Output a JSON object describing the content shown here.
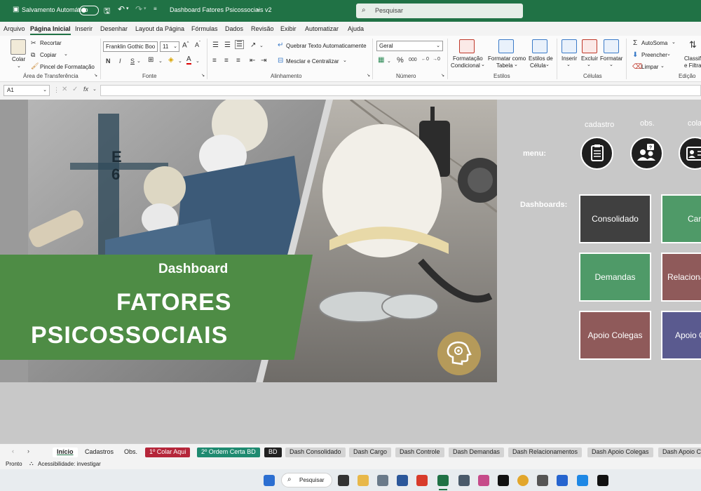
{
  "titlebar": {
    "autosave_label": "Salvamento Automático",
    "doc_title": "Dashboard Fatores Psicossociais v2",
    "search_placeholder": "Pesquisar"
  },
  "menu_tabs": [
    "Arquivo",
    "Página Inicial",
    "Inserir",
    "Desenhar",
    "Layout da Página",
    "Fórmulas",
    "Dados",
    "Revisão",
    "Exibir",
    "Automatizar",
    "Ajuda"
  ],
  "ribbon": {
    "colar": "Colar",
    "recortar": "Recortar",
    "copiar": "Copiar",
    "pincel": "Pincel de Formatação",
    "group_clipboard": "Área de Transferência",
    "font_name": "Franklin Gothic Boo",
    "font_size": "11",
    "group_font": "Fonte",
    "wrap_text": "Quebrar Texto Automaticamente",
    "merge_center": "Mesclar e Centralizar",
    "group_alignment": "Alinhamento",
    "number_format": "Geral",
    "group_number": "Número",
    "cond_format": [
      "Formatação",
      "Condicional"
    ],
    "format_table": [
      "Formatar como",
      "Tabela"
    ],
    "cell_styles": [
      "Estilos de",
      "Célula"
    ],
    "group_styles": "Estilos",
    "insert": "Inserir",
    "delete": "Excluir",
    "format": "Formatar",
    "group_cells": "Células",
    "autosum": "AutoSoma",
    "fill": "Preencher",
    "clear": "Limpar",
    "sort_filter": [
      "Classifi",
      "e Filtra"
    ],
    "group_editing": "Edição"
  },
  "formula_bar": {
    "name_box": "A1",
    "fx": "fx"
  },
  "hero": {
    "subtitle": "Dashboard",
    "title_line1": "FATORES",
    "title_line2": "PSICOSSOCIAIS",
    "sign_letter": "E",
    "sign_number": "6"
  },
  "menu": {
    "label": "menu:",
    "items": [
      {
        "label": "cadastro",
        "icon": "clipboard-icon"
      },
      {
        "label": "obs.",
        "icon": "person-question-icon"
      },
      {
        "label": "cola",
        "icon": "id-card-icon"
      }
    ]
  },
  "dashboards": {
    "label": "Dashboards:",
    "buttons": [
      {
        "label": "Consolidado",
        "color": "#404040"
      },
      {
        "label": "Carg",
        "color": "#4f9a68"
      },
      {
        "label": "Demandas",
        "color": "#4f9a68"
      },
      {
        "label": "Relaciona",
        "color": "#8f5a5a"
      },
      {
        "label": "Apoio Colegas",
        "color": "#8f5a5a"
      },
      {
        "label": "Apoio C",
        "color": "#5a5a8f"
      }
    ]
  },
  "sheet_tabs": [
    {
      "label": "Início",
      "bg": "#ffffff",
      "fg": "#222222"
    },
    {
      "label": "Cadastros",
      "bg": "#f3f3f3",
      "fg": "#222222"
    },
    {
      "label": "Obs.",
      "bg": "#f3f3f3",
      "fg": "#222222"
    },
    {
      "label": "1º Colar Aqui",
      "bg": "#b5263a",
      "fg": "#ffffff"
    },
    {
      "label": "2º Ordem Certa BD",
      "bg": "#1f8a70",
      "fg": "#ffffff"
    },
    {
      "label": "BD",
      "bg": "#222222",
      "fg": "#ffffff"
    },
    {
      "label": "Dash Consolidado",
      "bg": "#d4d4d4",
      "fg": "#222222"
    },
    {
      "label": "Dash Cargo",
      "bg": "#d4d4d4",
      "fg": "#222222"
    },
    {
      "label": "Dash Controle",
      "bg": "#d4d4d4",
      "fg": "#222222"
    },
    {
      "label": "Dash Demandas",
      "bg": "#d4d4d4",
      "fg": "#222222"
    },
    {
      "label": "Dash Relacionamentos",
      "bg": "#d4d4d4",
      "fg": "#222222"
    },
    {
      "label": "Dash Apoio Colegas",
      "bg": "#d4d4d4",
      "fg": "#222222"
    },
    {
      "label": "Dash Apoio C",
      "bg": "#d4d4d4",
      "fg": "#222222"
    }
  ],
  "statusbar": {
    "ready": "Pronto",
    "accessibility": "Acessibilidade: investigar"
  },
  "taskbar": {
    "search": "Pesquisar"
  },
  "colors": {
    "excel_green": "#207245",
    "banner_green": "#4e8c45",
    "brain_gold": "#b59a5a"
  }
}
